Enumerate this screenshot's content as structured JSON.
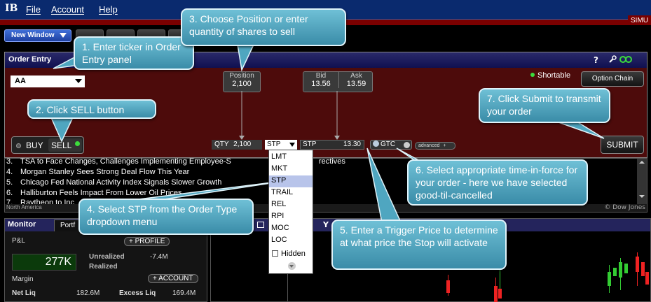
{
  "app": {
    "logo": "IB",
    "menu": [
      "File",
      "Account",
      "Help"
    ],
    "mode_badge": "SIMU",
    "new_window_label": "New Window"
  },
  "order_entry": {
    "title": "Order Entry",
    "help_icon": "?",
    "ticker": "AA",
    "position": {
      "label": "Position",
      "value": "2,100"
    },
    "bid": {
      "label": "Bid",
      "value": "13.56"
    },
    "ask": {
      "label": "Ask",
      "value": "13.59"
    },
    "shortable": "Shortable",
    "option_chain": "Option Chain",
    "buy": "BUY",
    "sell": "SELL",
    "qty_label": "QTY",
    "qty_value": "2,100",
    "order_type": "STP",
    "price_type": "STP",
    "price_value": "13.30",
    "tif": "GTC",
    "advanced": "advanced",
    "submit": "SUBMIT"
  },
  "order_type_dropdown": {
    "options": [
      "LMT",
      "MKT",
      "STP",
      "TRAIL",
      "REL",
      "RPI",
      "MOC",
      "LOC"
    ],
    "selected": "STP",
    "hidden_label": "Hidden"
  },
  "news": {
    "items": [
      {
        "num": "3.",
        "text": "TSA to Face Changes, Challenges Implementing Employee-S",
        "tail": "rectives"
      },
      {
        "num": "4.",
        "text": "Morgan Stanley  Sees Strong Deal Flow This Year",
        "tail": ""
      },
      {
        "num": "5.",
        "text": "Chicago Fed  National Activity Index Signals Slower Growth",
        "tail": ""
      },
      {
        "num": "6.",
        "text": "Halliburton  Feels Impact From Lower Oil Prices",
        "tail": ""
      },
      {
        "num": "7.",
        "text": "Raytheon  to Inc",
        "tail": ""
      }
    ],
    "region": "North America",
    "source": "© Dow Jones"
  },
  "monitor": {
    "title": "Monitor",
    "tab": "Portf",
    "pnl_label": "P&L",
    "profile_btn": "+ PROFILE",
    "pnl_value": "277K",
    "unrealized_label": "Unrealized",
    "unrealized_value": "-7.4M",
    "realized_label": "Realized",
    "margin_label": "Margin",
    "account_btn": "+ ACCOUNT",
    "net_liq_label": "Net Liq",
    "net_liq_value": "182.6M",
    "excess_liq_label": "Excess Liq",
    "excess_liq_value": "169.4M"
  },
  "chart_panel": {
    "header_fragment": "Y"
  },
  "callouts": {
    "c1": "1. Enter ticker in Order Entry panel",
    "c2": "2. Click SELL button",
    "c3": "3. Choose Position or enter quantity of shares to sell",
    "c4": "4. Select STP from the Order Type dropdown menu",
    "c5": "5. Enter a Trigger Price to determine at what price the Stop will activate",
    "c6": "6. Select appropriate time-in-force for your order - here we have selected good-til-cancelled",
    "c7": "7. Click Submit to transmit your order"
  },
  "colors": {
    "menubar": "#0a2a6e",
    "order_body": "#4d0b0b",
    "callout": "#4fa6c0",
    "led_green": "#3cdc3c"
  }
}
